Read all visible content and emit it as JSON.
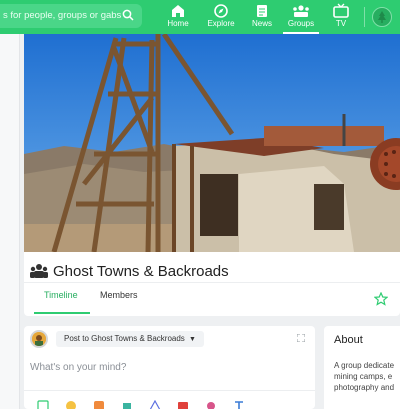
{
  "search": {
    "placeholder": "s for people, groups or gabs"
  },
  "nav": [
    {
      "label": "Home",
      "icon": "home-icon"
    },
    {
      "label": "Explore",
      "icon": "compass-icon"
    },
    {
      "label": "News",
      "icon": "news-icon"
    },
    {
      "label": "Groups",
      "icon": "groups-icon",
      "active": true
    },
    {
      "label": "TV",
      "icon": "tv-icon"
    }
  ],
  "group": {
    "title": "Ghost Towns & Backroads",
    "tabs": [
      {
        "label": "Timeline",
        "active": true
      },
      {
        "label": "Members"
      }
    ]
  },
  "composer": {
    "target_label": "Post to Ghost Towns & Backroads",
    "placeholder": "What's on your mind?"
  },
  "about": {
    "heading": "About",
    "description_lines": [
      "A group dedicate",
      "mining camps, e",
      "photography and"
    ]
  },
  "colors": {
    "brand_green": "#2ecc71",
    "active_tab": "#27ae60"
  }
}
